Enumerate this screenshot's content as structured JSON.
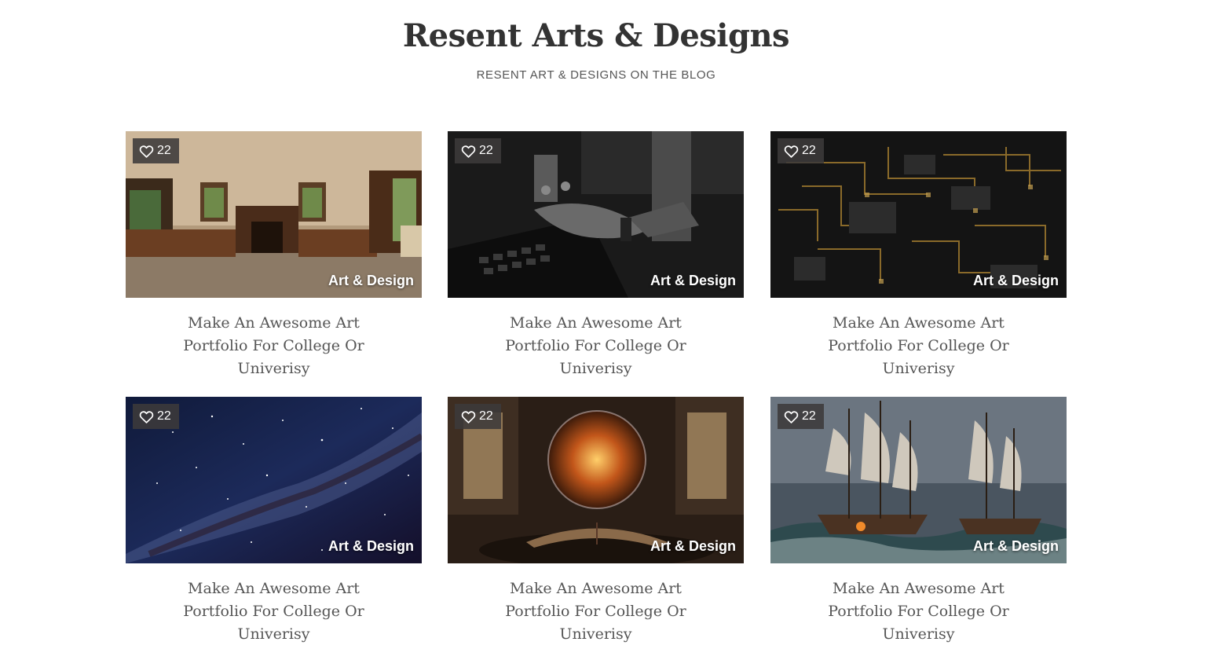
{
  "section": {
    "title": "Resent Arts & Designs",
    "subtitle": "RESENT ART & DESIGNS ON THE BLOG"
  },
  "posts": [
    {
      "likes": "22",
      "category": "Art & Design",
      "title": "Make An Awesome Art Portfolio For College Or Univerisy",
      "image": "home-office-interior"
    },
    {
      "likes": "22",
      "category": "Art & Design",
      "title": "Make An Awesome Art Portfolio For College Or Univerisy",
      "image": "hand-on-keyboard-bw"
    },
    {
      "likes": "22",
      "category": "Art & Design",
      "title": "Make An Awesome Art Portfolio For College Or Univerisy",
      "image": "gold-circuit-board"
    },
    {
      "likes": "22",
      "category": "Art & Design",
      "title": "Make An Awesome Art Portfolio For College Or Univerisy",
      "image": "milky-way-night-sky"
    },
    {
      "likes": "22",
      "category": "Art & Design",
      "title": "Make An Awesome Art Portfolio For College Or Univerisy",
      "image": "glowing-orb-over-book"
    },
    {
      "likes": "22",
      "category": "Art & Design",
      "title": "Make An Awesome Art Portfolio For College Or Univerisy",
      "image": "sailing-ships-battle"
    }
  ],
  "colors": {
    "heading": "#333333",
    "text": "#555555",
    "badge_bg": "#3c3a3a"
  },
  "icons": {
    "likes": "heart-outline-icon"
  }
}
